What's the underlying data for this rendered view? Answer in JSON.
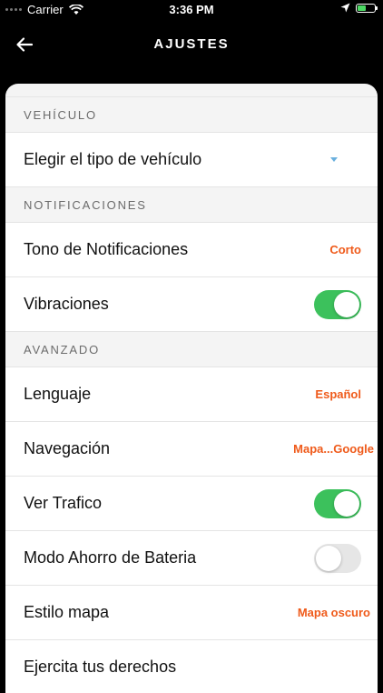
{
  "status_bar": {
    "carrier": "Carrier",
    "time": "3:36 PM"
  },
  "header": {
    "title": "AJUSTES"
  },
  "sections": {
    "vehicle": {
      "title": "VEHÍCULO",
      "vehicle_type_label": "Elegir el tipo de vehículo"
    },
    "notifications": {
      "title": "NOTIFICACIONES",
      "tone_label": "Tono de Notificaciones",
      "tone_value": "Corto",
      "vibration_label": "Vibraciones",
      "vibration_on": true
    },
    "advanced": {
      "title": "AVANZADO",
      "language_label": "Lenguaje",
      "language_value": "Español",
      "navigation_label": "Navegación",
      "navigation_value": "Mapa...Google",
      "traffic_label": "Ver Trafico",
      "traffic_on": true,
      "battery_saver_label": "Modo Ahorro de Bateria",
      "battery_saver_on": false,
      "map_style_label": "Estilo mapa",
      "map_style_value": "Mapa oscuro",
      "rights_label": "Ejercita tus derechos"
    }
  },
  "colors": {
    "accent_orange": "#ef5a1a",
    "toggle_on": "#3cc15c",
    "caret_blue": "#6ab0de"
  }
}
